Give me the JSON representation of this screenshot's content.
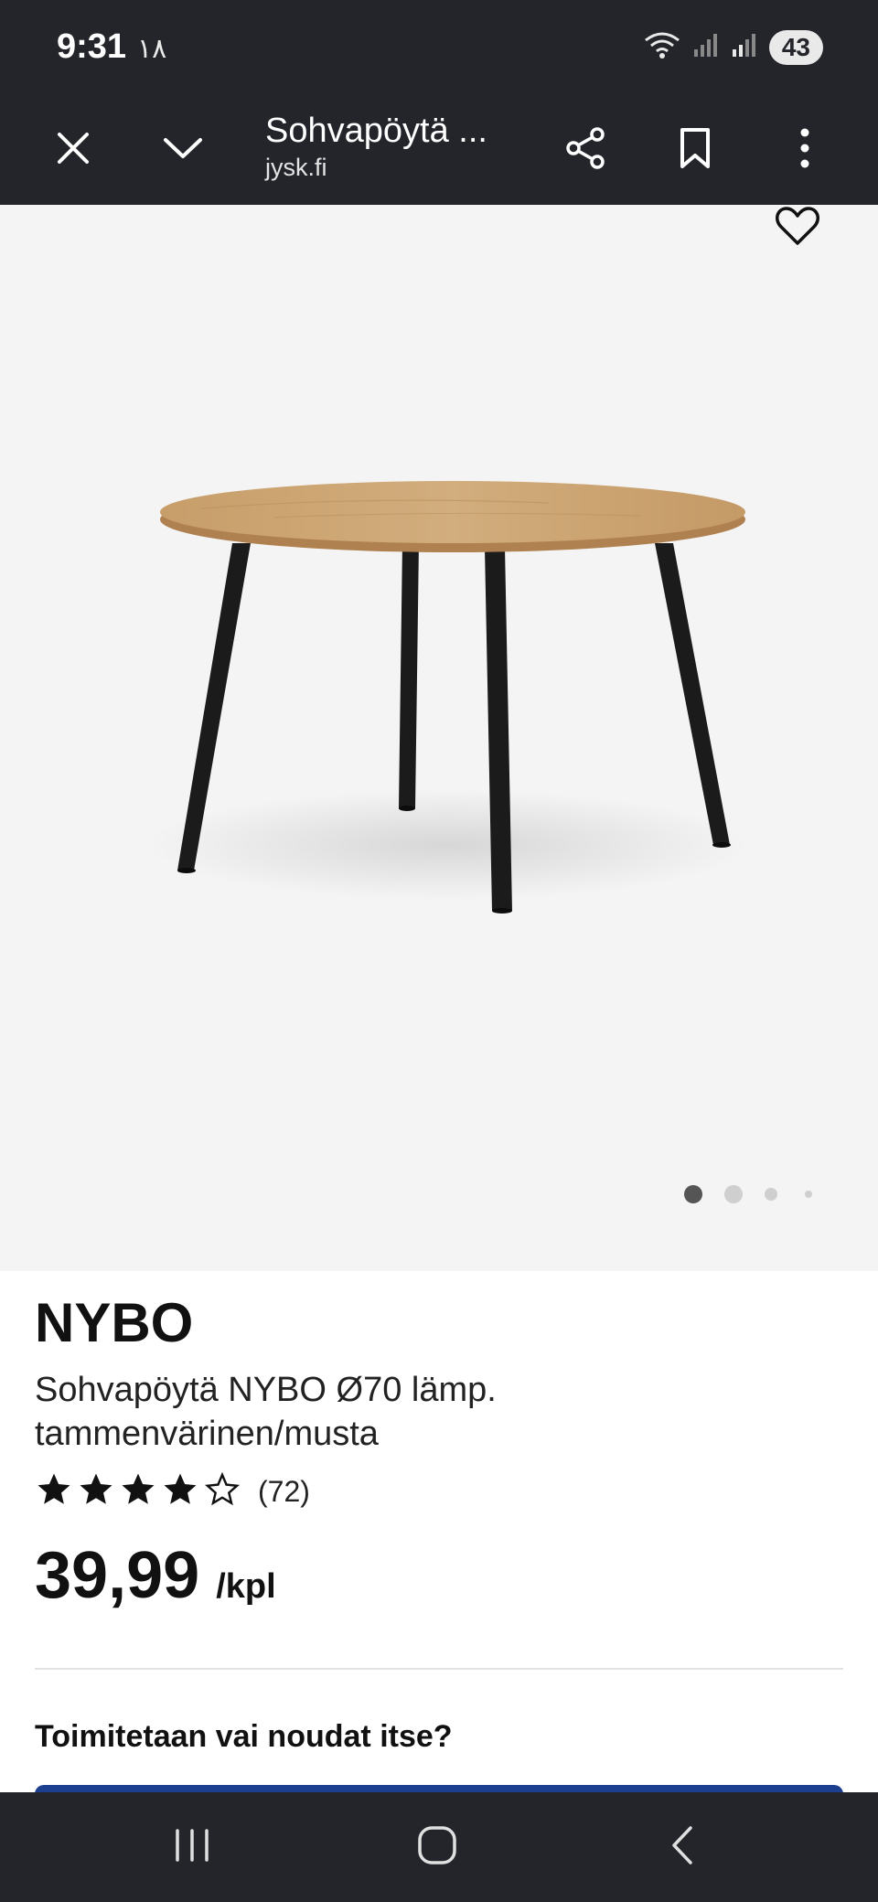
{
  "status_bar": {
    "time": "9:31",
    "extra": "١٨",
    "battery": "43"
  },
  "browser": {
    "page_title": "Sohvapöytä ...",
    "domain": "jysk.fi",
    "icons": [
      "close-icon",
      "chevron-down-icon",
      "share-icon",
      "bookmark-icon",
      "more-vert-icon"
    ]
  },
  "gallery": {
    "slide_count": 4,
    "active_slide": 1
  },
  "product": {
    "name": "NYBO",
    "description": "Sohvapöytä NYBO Ø70 lämp. tammenvärinen/musta",
    "rating": 4,
    "rating_max": 5,
    "review_count": "(72)",
    "price": "39,99",
    "price_unit": "/kpl"
  },
  "delivery": {
    "question": "Toimitetaan vai noudat itse?"
  },
  "colors": {
    "system_bar": "#23252b",
    "image_background": "#f4f4f4",
    "tabletop": "#c9a473",
    "legs": "#1b1b1b",
    "accent_blue": "#1d3f8f"
  }
}
